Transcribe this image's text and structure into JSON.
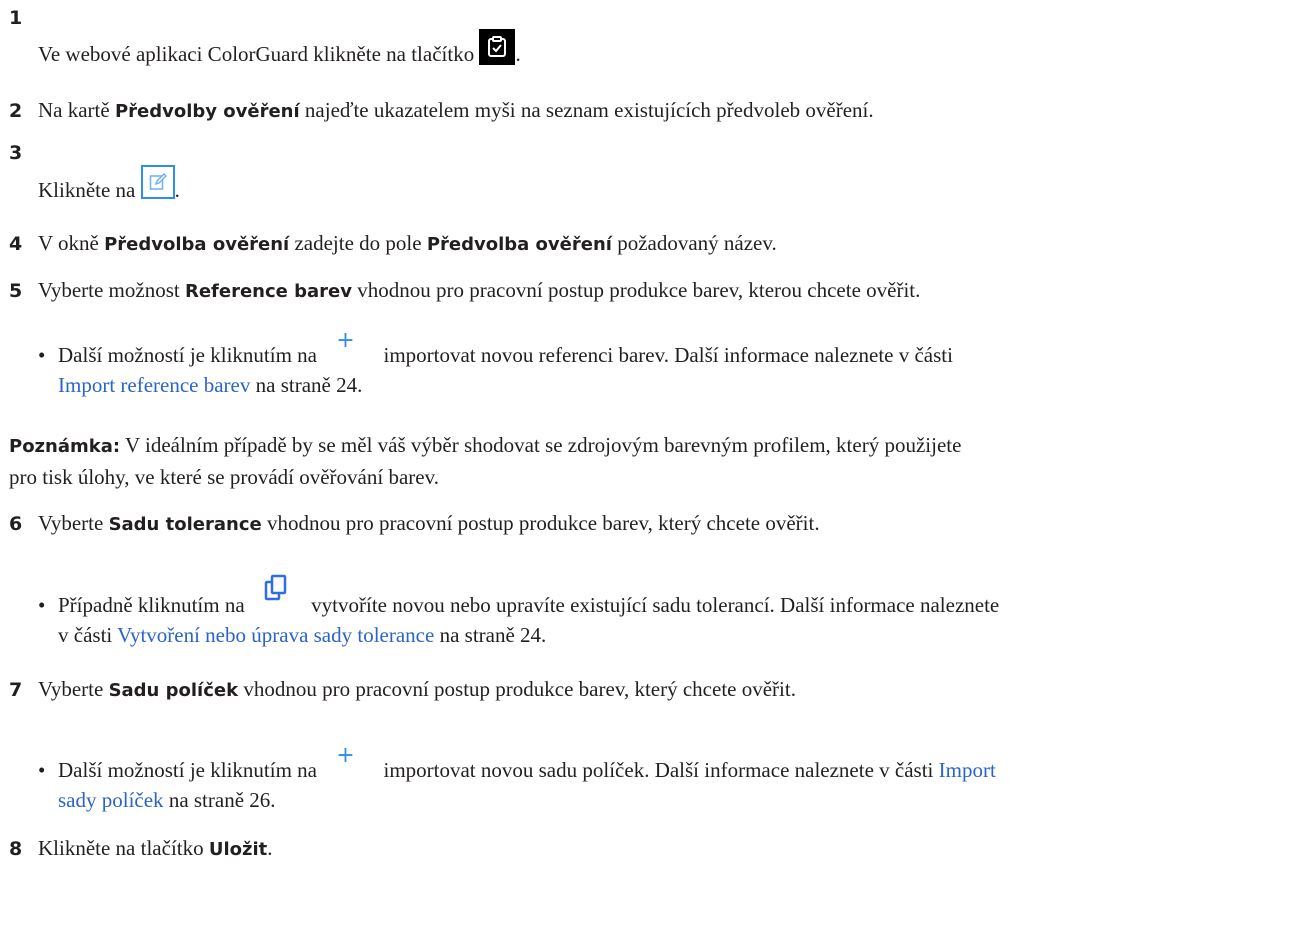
{
  "steps": [
    {
      "num": "1",
      "text_before": "Ve webové aplikaci ColorGuard klikněte na tlačítko ",
      "text_after": ".",
      "icon": "clipboard-check-icon"
    },
    {
      "num": "2",
      "t1": "Na kartě ",
      "b1": "Předvolby ověření",
      "t2": " najeďte ukazatelem myši na seznam existujících předvoleb ověření."
    },
    {
      "num": "3",
      "text_before": "Klikněte na ",
      "text_after": ".",
      "icon": "edit-icon"
    },
    {
      "num": "4",
      "t1": "V okně ",
      "b1": "Předvolba ověření",
      "t2": " zadejte do pole ",
      "b2": "Předvolba ověření",
      "t3": " požadovaný název."
    },
    {
      "num": "5",
      "t1": "Vyberte možnost ",
      "b1": "Reference barev",
      "t2": " vhodnou pro pracovní postup produkce barev, kterou chcete ověřit."
    },
    {
      "num": "6",
      "t1": "Vyberte ",
      "b1": "Sadu tolerance",
      "t2": " vhodnou pro pracovní postup produkce barev, který chcete ověřit."
    },
    {
      "num": "7",
      "t1": "Vyberte ",
      "b1": "Sadu políček",
      "t2": " vhodnou pro pracovní postup produkce barev, který chcete ověřit."
    },
    {
      "num": "8",
      "t1": "Klikněte na tlačítko ",
      "b1": "Uložit",
      "t2": "."
    }
  ],
  "bullet5": {
    "line1_before": "Další možností je kliknutím na ",
    "line1_after": " importovat novou referenci barev. Další informace naleznete v části",
    "link": "Import reference barev",
    "after": " na straně 24.",
    "icon": "plus-icon"
  },
  "note": {
    "label": "Poznámka:",
    "line1": " V ideálním případě by se měl váš výběr shodovat se zdrojovým barevným profilem, který použijete",
    "line2": "pro tisk úlohy, ve které se provádí ověřování barev."
  },
  "bullet6": {
    "line1_before": "Případně kliknutím na ",
    "line1_after": " vytvoříte novou nebo upravíte existující sadu tolerancí. Další informace naleznete",
    "line2_before": "v části ",
    "link": "Vytvoření nebo úprava sady tolerance",
    "after": " na straně 24.",
    "icon": "copy-icon"
  },
  "bullet7": {
    "line1_before": "Další možností je kliknutím na ",
    "line1_after": " importovat novou sadu políček. Další informace naleznete v části ",
    "link1": "Import",
    "link2": "sady políček",
    "after": " na straně 26.",
    "icon": "plus-icon"
  },
  "colors": {
    "link": "#2a64c8",
    "plus": "#2f8fe8",
    "edit_border": "#2f8fe8",
    "icon_dark": "#000000"
  }
}
